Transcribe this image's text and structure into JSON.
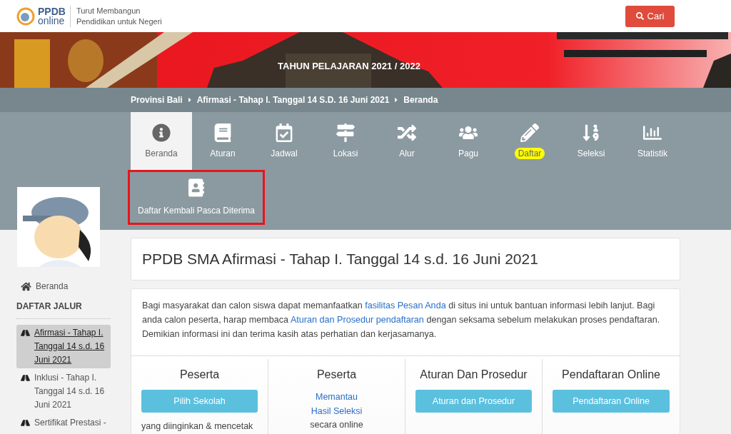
{
  "header": {
    "logo": {
      "top": "PPDB",
      "bottom": "online"
    },
    "tagline": [
      "Turut Membangun",
      "Pendidikan untuk Negeri"
    ],
    "search_button": "Cari"
  },
  "banner": {
    "kind": "picture",
    "caption": "TAHUN PELAJARAN 2021 / 2022"
  },
  "breadcrumb": [
    "Provinsi Bali",
    "Afirmasi - Tahap I. Tanggal 14 S.D. 16 Juni 2021",
    "Beranda"
  ],
  "nav_tabs": [
    {
      "label": "Beranda",
      "selected": true,
      "highlighted": false
    },
    {
      "label": "Aturan",
      "selected": false,
      "highlighted": false
    },
    {
      "label": "Jadwal",
      "selected": false,
      "highlighted": false
    },
    {
      "label": "Lokasi",
      "selected": false,
      "highlighted": false
    },
    {
      "label": "Alur",
      "selected": false,
      "highlighted": false
    },
    {
      "label": "Pagu",
      "selected": false,
      "highlighted": false
    },
    {
      "label": "Daftar",
      "selected": false,
      "highlighted": true
    },
    {
      "label": "Seleksi",
      "selected": false,
      "highlighted": false
    },
    {
      "label": "Statistik",
      "selected": false,
      "highlighted": false
    }
  ],
  "sub_nav": {
    "label": "Daftar Kembali Pasca Diterima",
    "outlined": true
  },
  "sidebar": {
    "home_link": "Beranda",
    "heading": "DAFTAR JALUR",
    "items": [
      {
        "label": "Afirmasi - Tahap I. Tanggal 14 s.d. 16 Juni 2021",
        "selected": true
      },
      {
        "label": "Inklusi - Tahap I. Tanggal 14 s.d. 16 Juni 2021",
        "selected": false
      },
      {
        "label": "Sertifikat Prestasi -",
        "selected": false
      }
    ]
  },
  "page_title": "PPDB SMA Afirmasi - Tahap I. Tanggal 14 s.d. 16 Juni 2021",
  "intro": [
    {
      "kind": "text",
      "text": "Bagi masyarakat dan calon siswa dapat memanfaatkan "
    },
    {
      "kind": "link",
      "text": "fasilitas Pesan Anda"
    },
    {
      "kind": "text",
      "text": " di situs ini untuk bantuan informasi lebih lanjut. Bagi anda calon peserta, harap membaca "
    },
    {
      "kind": "link",
      "text": "Aturan dan Prosedur pendaftaran"
    },
    {
      "kind": "text",
      "text": " dengan seksama sebelum melakukan proses pendaftaran. Demikian informasi ini dan terima kasih atas perhatian dan kerjasamanya."
    }
  ],
  "columns": [
    {
      "title": "Peserta",
      "kind": "button",
      "button": "Pilih Sekolah",
      "note": "yang diinginkan & mencetak"
    },
    {
      "title": "Peserta",
      "kind": "links",
      "links": [
        "Memantau",
        "Hasil Seleksi"
      ],
      "note": "secara online"
    },
    {
      "title": "Aturan Dan Prosedur",
      "kind": "button",
      "button": "Aturan dan Prosedur"
    },
    {
      "title": "Pendaftaran Online",
      "kind": "button",
      "button": "Pendaftaran Online"
    }
  ]
}
